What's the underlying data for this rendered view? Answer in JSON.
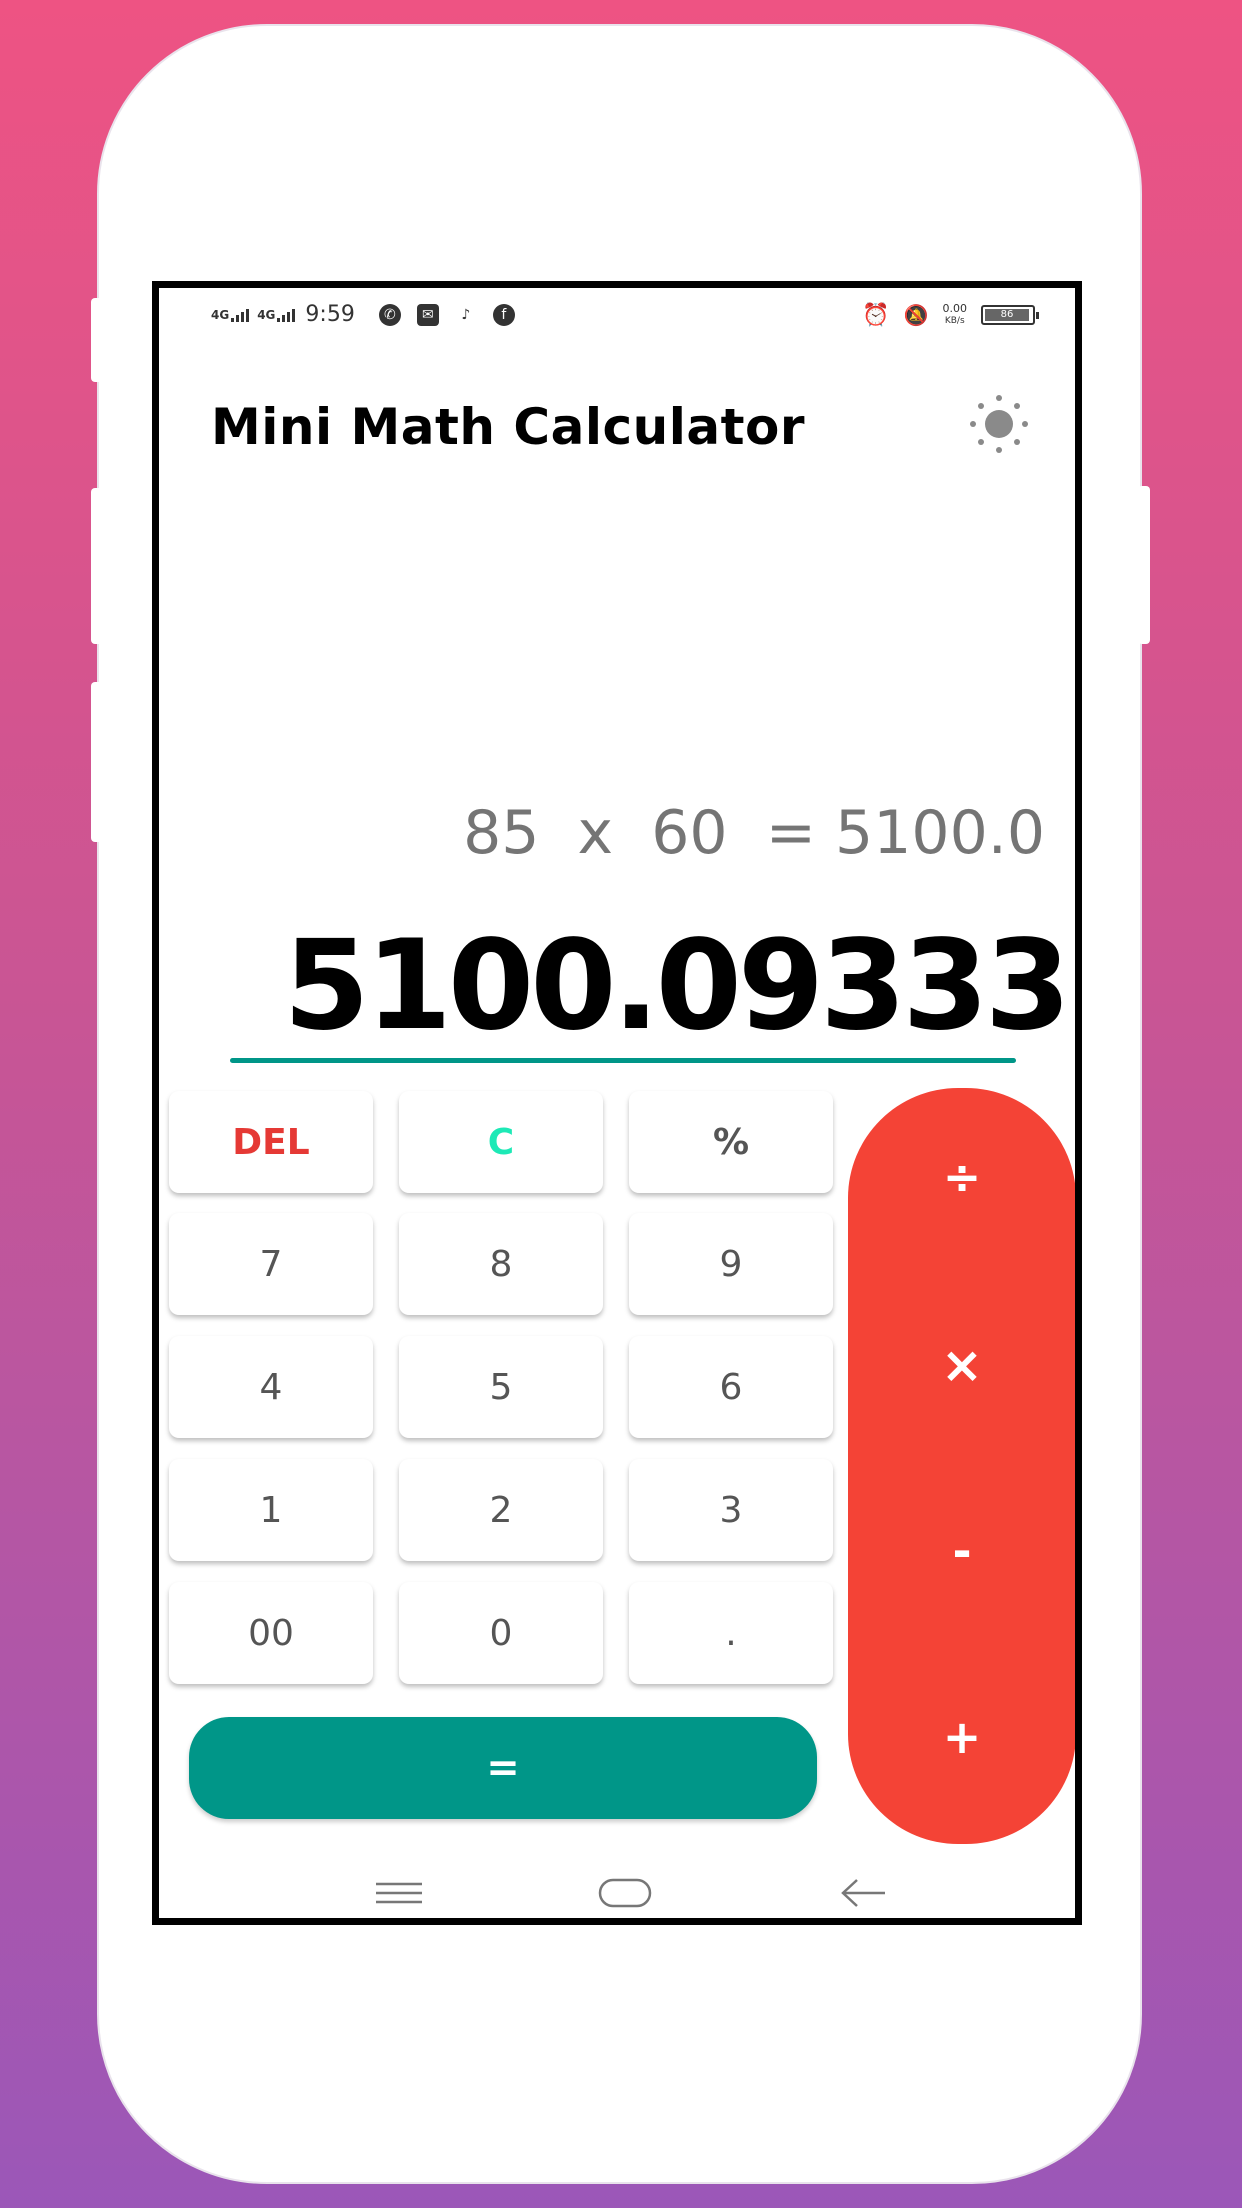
{
  "status_bar": {
    "signal1": "4G",
    "signal2": "4G",
    "time": "9:59",
    "speed_value": "0.00",
    "speed_unit": "KB/s",
    "battery": "86"
  },
  "app": {
    "title": "Mini Math Calculator",
    "theme_icon": "sun-icon"
  },
  "display": {
    "expression": "85  x  60  = 5100.0",
    "result": "5100.09333"
  },
  "keys": {
    "del": "DEL",
    "clear": "C",
    "percent": "%",
    "k7": "7",
    "k8": "8",
    "k9": "9",
    "k4": "4",
    "k5": "5",
    "k6": "6",
    "k1": "1",
    "k2": "2",
    "k3": "3",
    "k00": "00",
    "k0": "0",
    "dot": ".",
    "equals": "="
  },
  "operators": {
    "divide": "÷",
    "multiply": "×",
    "minus": "-",
    "plus": "+"
  },
  "colors": {
    "accent_teal": "#009688",
    "operator_red": "#f44336",
    "delete_red": "#e53935",
    "clear_cyan": "#1de9b6"
  }
}
